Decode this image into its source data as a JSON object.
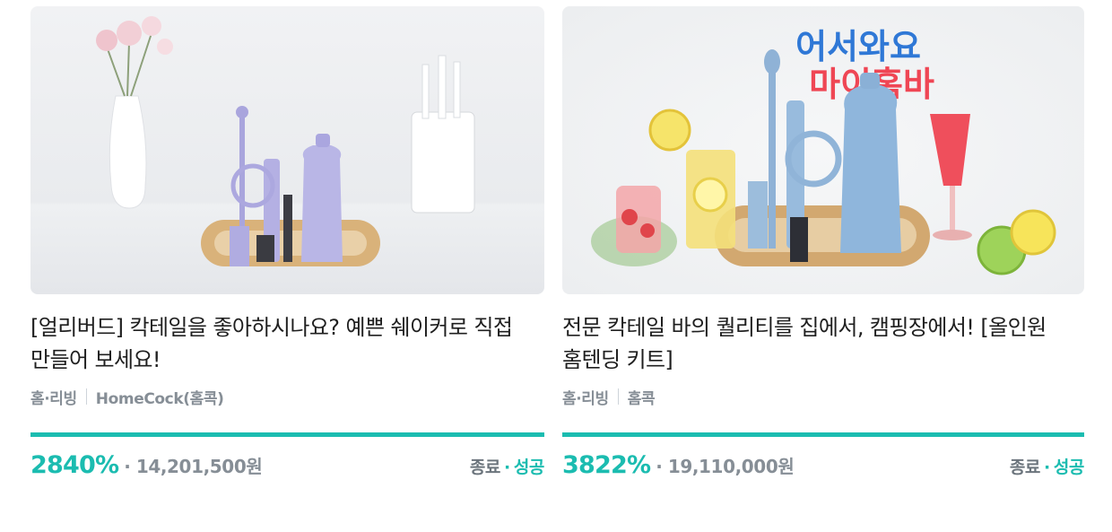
{
  "products": [
    {
      "title": "[얼리버드] 칵테일을 좋아하시나요? 예쁜 쉐이커로 직접 만들어 보세요!",
      "category": "홈·리빙",
      "maker": "HomeCock(홈콕)",
      "percent": "2840%",
      "percent_value": 2840,
      "amount": "14,201,500원",
      "status_end": "종료",
      "status_result": "성공",
      "image": {
        "desc_icon": "cocktail-set-photo-icon"
      }
    },
    {
      "title": "전문 칵테일 바의 퀄리티를 집에서, 캠핑장에서! [올인원 홈텐딩 키트]",
      "category": "홈·리빙",
      "maker": "홈콕",
      "percent": "3822%",
      "percent_value": 3822,
      "amount": "19,110,000원",
      "status_end": "종료",
      "status_result": "성공",
      "image": {
        "banner_line1": "어서와요",
        "banner_line2": "마이홈바",
        "desc_icon": "cocktail-kit-photo-icon"
      }
    }
  ],
  "colors": {
    "accent": "#1bbcb0",
    "muted": "#868e96"
  }
}
